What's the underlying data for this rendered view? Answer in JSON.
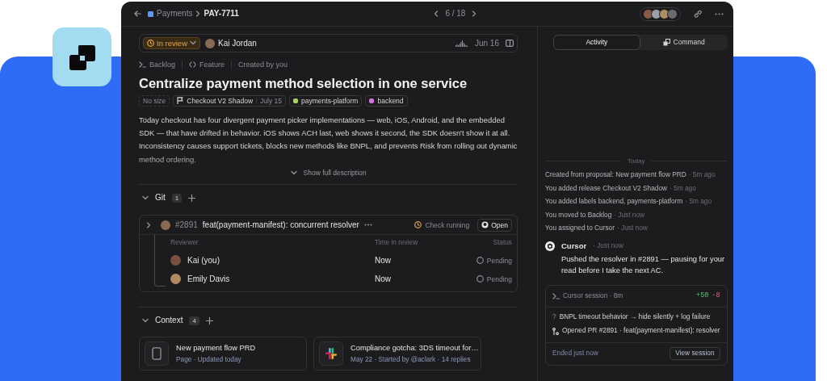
{
  "header": {
    "breadcrumb": [
      "Payments",
      "PAY-7711"
    ],
    "pager": "6 / 18"
  },
  "status_bar": {
    "status": "In review",
    "assignee": "Kai Jordan",
    "date": "Jun 16"
  },
  "issue": {
    "meta": [
      {
        "kind": "status",
        "label": "Backlog"
      },
      {
        "kind": "type",
        "label": "Feature"
      },
      {
        "kind": "plain",
        "label": "Created by you"
      }
    ],
    "title": "Centralize payment method selection in one service",
    "tags": [
      {
        "kind": "size",
        "label": "No size"
      },
      {
        "kind": "release",
        "label": "Checkout V2 Shadow",
        "date": "July 15"
      },
      {
        "kind": "label",
        "label": "payments-platform",
        "color": "#a6d45e"
      },
      {
        "kind": "label",
        "label": "backend",
        "color": "#d86fe0"
      }
    ],
    "description": "Today checkout has four divergent payment picker implementations —  web, iOS, Android, and the embedded SDK — that have drifted in behavior. iOS shows ACH last, web shows it second, the SDK doesn't show it at all. Inconsistency causes support tickets, blocks new methods like BNPL, and prevents Risk from rolling out dynamic method ordering.",
    "expand": "Show full description"
  },
  "git": {
    "title": "Git",
    "count": "1",
    "expanded": true,
    "pr": {
      "number": "#2891",
      "title": "feat(payment-manifest): concurrent resolver",
      "check": "Check running",
      "open": "Open",
      "expanded": false,
      "columns": [
        "Reviewer",
        "Time in review",
        "Status"
      ],
      "rows": [
        {
          "name": "Kai (you)",
          "time": "Now",
          "status": "Pending"
        },
        {
          "name": "Emily Davis",
          "time": "Now",
          "status": "Pending"
        }
      ]
    }
  },
  "context": {
    "title": "Context",
    "count": "4",
    "expanded": true,
    "cards": [
      {
        "kind": "page",
        "title": "New payment flow PRD",
        "meta": "Page · Updated today"
      },
      {
        "kind": "chat",
        "title": "Compliance gotcha: 3DS timeout for…",
        "meta": "May 22 · Started by @aclark · 14 replies"
      }
    ]
  },
  "panel": {
    "tabs": [
      {
        "label": "Activity",
        "selected": true
      },
      {
        "label": "Command",
        "selected": false
      }
    ],
    "day": "Today",
    "events": [
      {
        "text": "Created from proposal: New payment flow PRD",
        "time": "· 5m ago"
      },
      {
        "text": "You added release Checkout V2 Shadow",
        "time": "· 5m ago"
      },
      {
        "text": "You added labels backend, payments-platform",
        "time": "· 5m ago"
      },
      {
        "text": "You moved to Backlog",
        "time": "· Just now"
      },
      {
        "text": "You assigned to Cursor",
        "time": "· Just now"
      }
    ],
    "comment": {
      "author": "Cursor",
      "time": "· Just now",
      "text": "Pushed the resolver in #2891 — pausing for your read before I take the next AC."
    },
    "session": {
      "title": "Cursor session · 8m",
      "added": "+50",
      "removed": "-8",
      "items": [
        {
          "kind": "question",
          "marker": "?",
          "text": "BNPL timeout behavior → hide silently + log failure"
        },
        {
          "kind": "pr",
          "text": "Opened PR #2891 · feat(payment-manifest): resolver"
        }
      ],
      "footer": "Ended just now",
      "button": "View session"
    }
  }
}
